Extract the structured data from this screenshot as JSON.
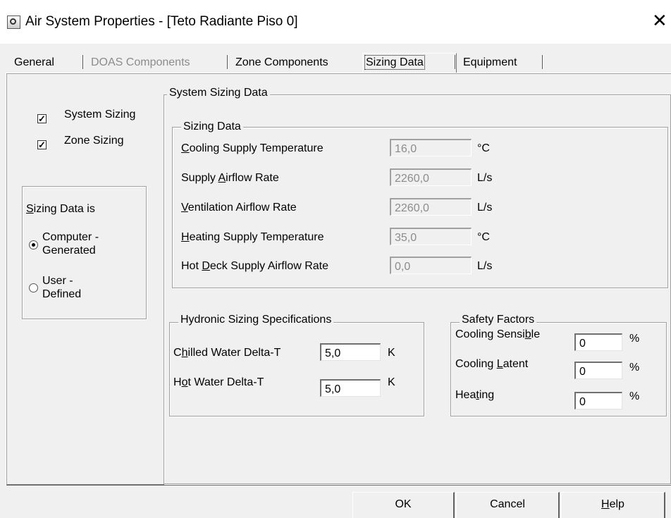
{
  "window": {
    "title": "Air System Properties - [Teto Radiante Piso 0]",
    "close_glyph": "✕",
    "icon": "app-icon"
  },
  "tabs": [
    {
      "label": "General",
      "state": "enabled"
    },
    {
      "label": "DOAS Components",
      "state": "disabled"
    },
    {
      "label": "Zone Components",
      "state": "enabled"
    },
    {
      "label": "Sizing Data",
      "state": "active"
    },
    {
      "label": "Equipment",
      "state": "enabled"
    }
  ],
  "options": {
    "system_sizing": {
      "label": "System Sizing",
      "checked": true
    },
    "zone_sizing": {
      "label": "Zone Sizing",
      "checked": true
    }
  },
  "sizing_source": {
    "legend_pre": "",
    "legend_u": "S",
    "legend_post": "izing Data is",
    "computer_line1": "Computer -",
    "computer_line2": "Generated",
    "user_line1": "User -",
    "user_line2": "Defined",
    "selected": "computer"
  },
  "system_sizing_data": {
    "legend": "System Sizing Data",
    "sizing_data_legend": "Sizing Data",
    "rows": [
      {
        "pre": "",
        "u": "C",
        "post": "ooling Supply Temperature",
        "value": "16,0",
        "unit": "°C"
      },
      {
        "pre": "Supply ",
        "u": "A",
        "post": "irflow Rate",
        "value": "2260,0",
        "unit": "L/s"
      },
      {
        "pre": "",
        "u": "V",
        "post": "entilation Airflow Rate",
        "value": "2260,0",
        "unit": "L/s"
      },
      {
        "pre": "",
        "u": "H",
        "post": "eating Supply Temperature",
        "value": "35,0",
        "unit": "°C"
      },
      {
        "pre": "Hot ",
        "u": "D",
        "post": "eck Supply Airflow Rate",
        "value": "0,0",
        "unit": "L/s"
      }
    ]
  },
  "hydronic": {
    "legend": "Hydronic Sizing Specifications",
    "rows": [
      {
        "pre": "C",
        "u": "h",
        "post": "illed Water Delta-T",
        "value": "5,0",
        "unit": "K"
      },
      {
        "pre": "H",
        "u": "o",
        "post": "t Water Delta-T",
        "value": "5,0",
        "unit": "K"
      }
    ]
  },
  "safety": {
    "legend": "Safety Factors",
    "rows": [
      {
        "pre": "Cooling Sensi",
        "u": "b",
        "post": "le",
        "value": "0",
        "unit": "%"
      },
      {
        "pre": "Cooling ",
        "u": "L",
        "post": "atent",
        "value": "0",
        "unit": "%"
      },
      {
        "pre": "Hea",
        "u": "t",
        "post": "ing",
        "value": "0",
        "unit": "%"
      }
    ]
  },
  "buttons": {
    "ok": "OK",
    "cancel": "Cancel",
    "help_u": "H",
    "help_post": "elp"
  }
}
